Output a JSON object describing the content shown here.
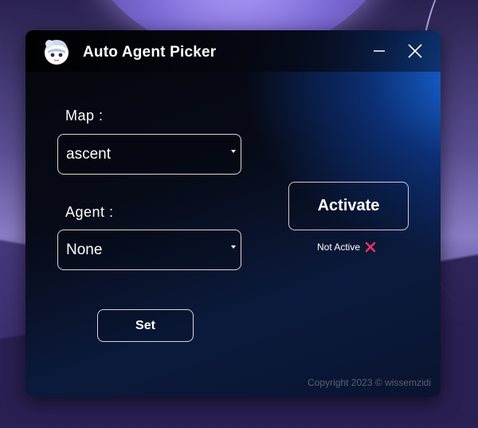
{
  "window": {
    "title": "Auto Agent Picker",
    "minimize_icon": "minimize-icon",
    "close_icon": "close-icon",
    "logo_icon": "app-logo-icon"
  },
  "map": {
    "label": "Map :",
    "selected": "ascent"
  },
  "agent": {
    "label": "Agent :",
    "selected": "None"
  },
  "buttons": {
    "set": "Set",
    "activate": "Activate"
  },
  "status": {
    "text": "Not Active",
    "icon": "cross-icon",
    "icon_color": "#e8335f"
  },
  "footer": {
    "copyright": "Copyright 2023 © wissemzidi"
  }
}
